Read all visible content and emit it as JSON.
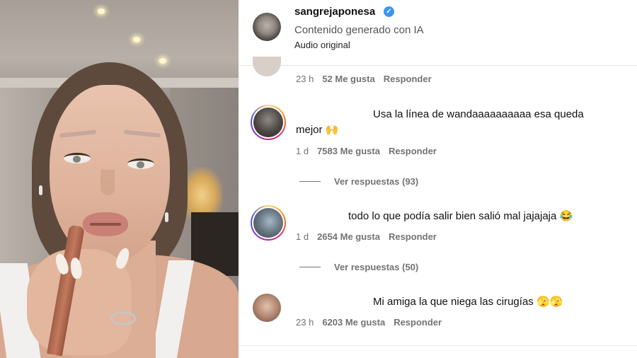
{
  "post": {
    "username": "sangrejaponesa",
    "verified_glyph": "✓",
    "ai_label": "Contenido generado con IA",
    "audio_label": "Audio original"
  },
  "comments": [
    {
      "time": "23 h",
      "likes": "52 Me gusta",
      "reply": "Responder"
    },
    {
      "text_line1": "Usa la línea de wandaaaaaaaaaa esa queda",
      "text_line2": "mejor 🙌",
      "time": "1 d",
      "likes": "7583 Me gusta",
      "reply": "Responder",
      "view_replies": "Ver respuestas (93)"
    },
    {
      "text_line1": "todo lo que podía salir bien salió mal jajajaja 😂",
      "time": "1 d",
      "likes": "2654 Me gusta",
      "reply": "Responder",
      "view_replies": "Ver respuestas (50)"
    },
    {
      "text_line1": "Mi amiga la que niega las cirugías 🫣🫣",
      "time": "23 h",
      "likes": "6203 Me gusta",
      "reply": "Responder"
    }
  ],
  "icons": {
    "verified": "verified-badge-icon"
  },
  "colors": {
    "verified_blue": "#3b97f0",
    "meta_gray": "#737373"
  }
}
